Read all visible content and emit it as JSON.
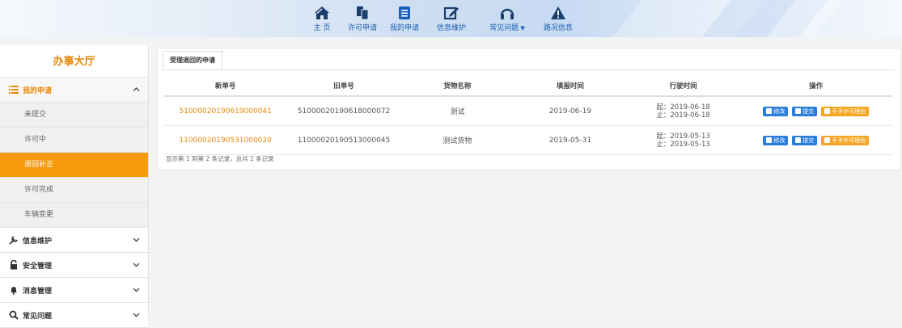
{
  "nav": {
    "items": [
      {
        "label": "主 页",
        "icon": "home-icon"
      },
      {
        "label": "许可申请",
        "icon": "documents-icon"
      },
      {
        "label": "我的申请",
        "icon": "list-icon"
      },
      {
        "label": "信息维护",
        "icon": "edit-icon"
      },
      {
        "label": "常见问题",
        "icon": "headphones-icon"
      },
      {
        "label": "路况信息",
        "icon": "warning-icon"
      }
    ],
    "active_index": 2,
    "accent_color": "#1a5fb4"
  },
  "sidebar": {
    "title": "办事大厅",
    "my_applications": {
      "label": "我的申请",
      "items": [
        {
          "label": "未提交"
        },
        {
          "label": "许可中"
        },
        {
          "label": "退回补正"
        },
        {
          "label": "许可完成"
        },
        {
          "label": "车辆变更"
        }
      ],
      "active_index": 2
    },
    "groups": [
      {
        "label": "信息维护",
        "icon": "wrench-icon"
      },
      {
        "label": "安全管理",
        "icon": "lock-icon"
      },
      {
        "label": "消息管理",
        "icon": "bell-icon"
      },
      {
        "label": "常见问题",
        "icon": "search-icon"
      }
    ],
    "accent_color": "#f59a0c"
  },
  "main": {
    "tab_label": "受理退回的申请",
    "columns": [
      "新单号",
      "旧单号",
      "货物名称",
      "填报时间",
      "行驶时间",
      "操作"
    ],
    "rows": [
      {
        "new_no": "5100002019061900004​1",
        "old_no": "510000201906180000​72",
        "goods": "测试",
        "filled": "2019-06-19",
        "start": "起：2019-06-18",
        "end": "止：2019-06-18"
      },
      {
        "new_no": "110000201905310000​20",
        "old_no": "110000201905130000​45",
        "goods": "测试货物",
        "filled": "2019-05-31",
        "start": "起：2019-05-13",
        "end": "止：2019-05-13"
      }
    ],
    "actions": {
      "edit": "修改",
      "submit": "提交",
      "reason": "不予许可理由"
    },
    "summary": "显示第 1 到第 2 条记录，总共 2 条记录"
  }
}
